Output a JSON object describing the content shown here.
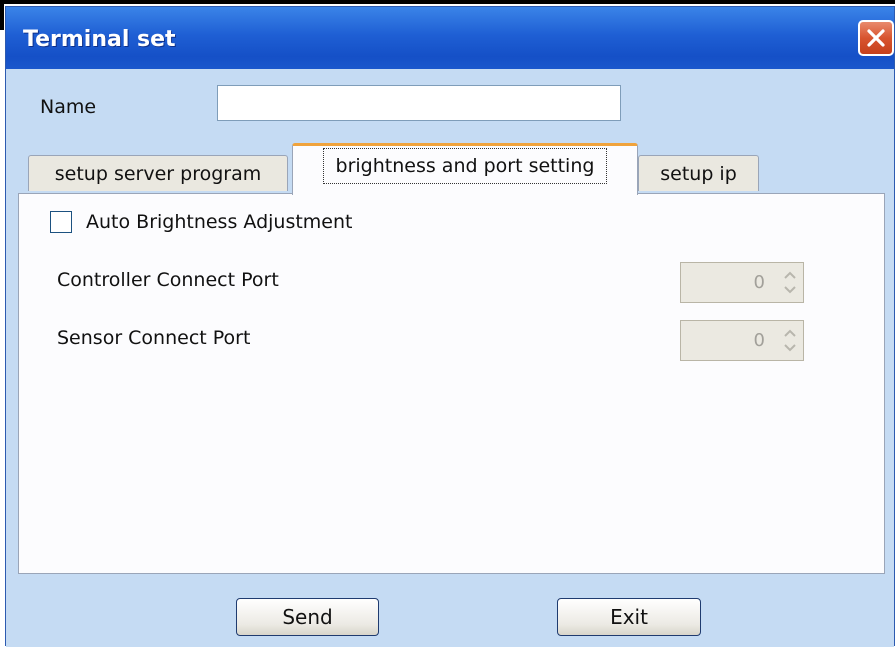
{
  "window": {
    "title": "Terminal set"
  },
  "name_field": {
    "label": "Name",
    "value": ""
  },
  "tabs": [
    {
      "label": "setup server program",
      "selected": false
    },
    {
      "label": "brightness and port setting",
      "selected": true
    },
    {
      "label": "setup ip",
      "selected": false
    }
  ],
  "panel": {
    "auto_brightness": {
      "label": "Auto Brightness Adjustment",
      "checked": false
    },
    "controller_port": {
      "label": "Controller Connect Port",
      "value": "0",
      "enabled": false
    },
    "sensor_port": {
      "label": "Sensor Connect Port",
      "value": "0",
      "enabled": false
    }
  },
  "buttons": {
    "send": "Send",
    "exit": "Exit"
  },
  "colors": {
    "titlebar": "#1f5fd4",
    "dialog_bg": "#c5dbf3",
    "selected_tab_accent": "#f0a33c",
    "close_button": "#d8542f"
  },
  "icons": {
    "close": "close-icon",
    "spinner_up": "chevron-up-icon",
    "spinner_down": "chevron-down-icon"
  }
}
